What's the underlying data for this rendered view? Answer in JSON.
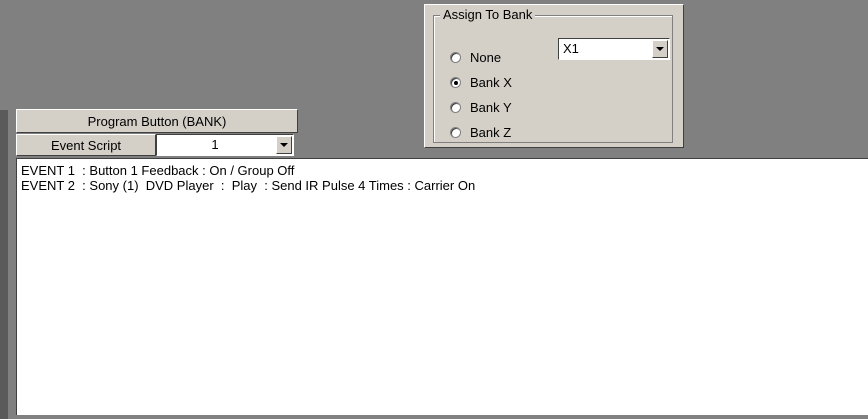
{
  "assign_to_bank": {
    "legend": "Assign To Bank",
    "options": [
      {
        "label": "None",
        "selected": false
      },
      {
        "label": "Bank X",
        "selected": true
      },
      {
        "label": "Bank Y",
        "selected": false
      },
      {
        "label": "Bank Z",
        "selected": false
      }
    ],
    "bank_select_value": "X1"
  },
  "program": {
    "header": "Program Button (BANK)",
    "event_script_label": "Event Script",
    "event_script_value": "1"
  },
  "events": [
    "EVENT 1  : Button 1 Feedback : On / Group Off",
    "EVENT 2  : Sony (1)  DVD Player  :  Play  : Send IR Pulse 4 Times : Carrier On"
  ],
  "colors": {
    "workspace": "#808080",
    "panel": "#d4d0c8",
    "text_area": "#ffffff"
  }
}
